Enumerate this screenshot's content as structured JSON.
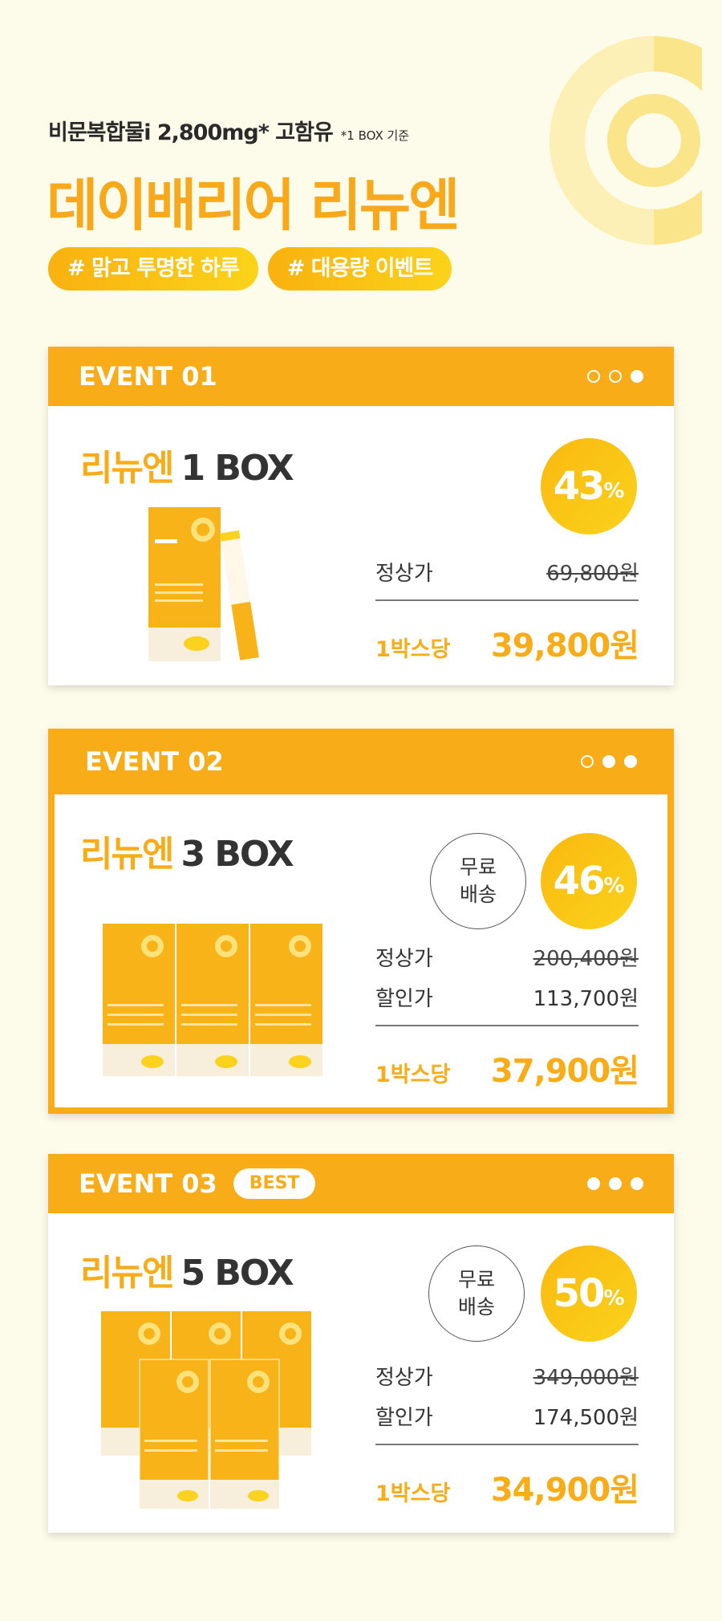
{
  "header": {
    "subtitle": "비문복합물i 2,800mg* 고함유",
    "subtitle_note": "*1 BOX 기준",
    "title": "데이배리어 리뉴엔",
    "tags": [
      "# 맑고 투명한 하루",
      "# 대용량 이벤트"
    ]
  },
  "events": [
    {
      "label": "EVENT 01",
      "product_name": "리뉴엔",
      "box": "1 BOX",
      "discount": "43",
      "discount_unit": "%",
      "regular_label": "정상가",
      "regular_price": "69,800원",
      "per_box_label": "1박스당",
      "per_box_price": "39,800원",
      "active_dot": 3
    },
    {
      "label": "EVENT 02",
      "product_name": "리뉴엔",
      "box": "3 BOX",
      "discount": "46",
      "discount_unit": "%",
      "free_shipping": "무료\n배송",
      "regular_label": "정상가",
      "regular_price": "200,400원",
      "sale_label": "할인가",
      "sale_price": "113,700원",
      "per_box_label": "1박스당",
      "per_box_price": "37,900원",
      "active_dot": 2
    },
    {
      "label": "EVENT 03",
      "badge": "BEST",
      "product_name": "리뉴엔",
      "box": "5 BOX",
      "discount": "50",
      "discount_unit": "%",
      "free_shipping": "무료\n배송",
      "regular_label": "정상가",
      "regular_price": "349,000원",
      "sale_label": "할인가",
      "sale_price": "174,500원",
      "per_box_label": "1박스당",
      "per_box_price": "34,900원",
      "active_dot": 1
    }
  ],
  "colors": {
    "accent": "#f8ac18",
    "background": "#fdfbe9",
    "text": "#333333"
  }
}
